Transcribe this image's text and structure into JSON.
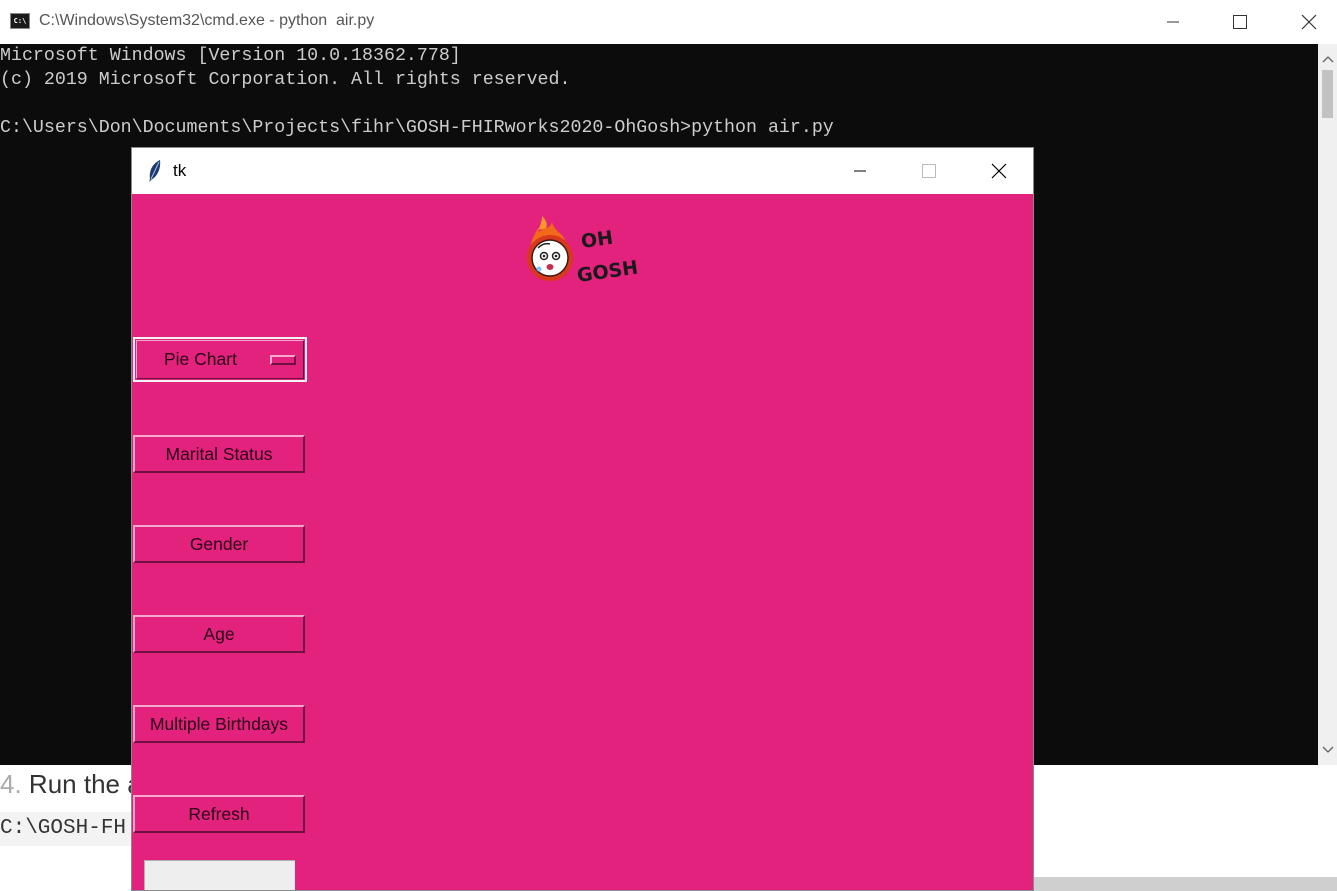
{
  "cmd": {
    "title": "C:\\Windows\\System32\\cmd.exe - python  air.py",
    "icon": "cmd-icon",
    "lines": [
      "Microsoft Windows [Version 10.0.18362.778]",
      "(c) 2019 Microsoft Corporation. All rights reserved.",
      "",
      "C:\\Users\\Don\\Documents\\Projects\\fihr\\GOSH-FHIRworks2020-OhGosh>python air.py"
    ]
  },
  "background_page": {
    "step_number": "4.",
    "step_text": "Run the a",
    "code_text": "C:\\GOSH-FH"
  },
  "tk": {
    "title": "tk",
    "icon": "feather-icon",
    "background_color": "#e2227d",
    "logo": {
      "line1": "OH",
      "line2": "GOSH"
    },
    "chart_type_menu": {
      "selected": "Pie Chart"
    },
    "buttons": [
      {
        "label": "Marital Status"
      },
      {
        "label": "Gender"
      },
      {
        "label": "Age"
      },
      {
        "label": "Multiple Birthdays"
      },
      {
        "label": "Refresh"
      }
    ],
    "entry": {
      "value": ""
    }
  }
}
